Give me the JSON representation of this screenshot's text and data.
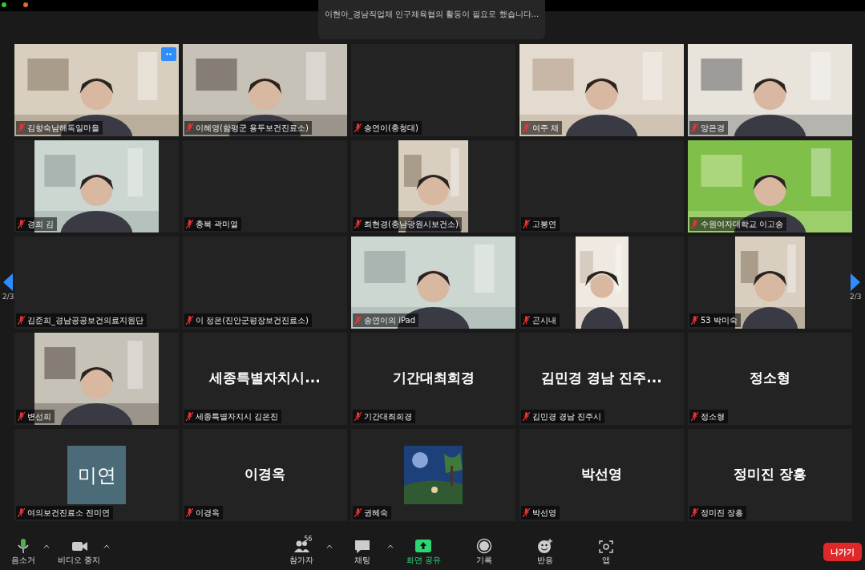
{
  "banner": {
    "text": "이현아_경남직업체 인구체육협의 활동이 필요로 했습니다..."
  },
  "pager": {
    "left": "2/3",
    "right": "2/3"
  },
  "tiles": [
    {
      "kind": "video",
      "label": "김향숙남해독일마을",
      "muted": true,
      "more_button": true
    },
    {
      "kind": "video",
      "label": "이혜영(함평군 용두보건진료소)",
      "muted": true
    },
    {
      "kind": "blank",
      "label": "송연이(충청대)",
      "muted": true
    },
    {
      "kind": "video",
      "label": "여주 채",
      "muted": true
    },
    {
      "kind": "video",
      "label": "양은경",
      "muted": true
    },
    {
      "kind": "portrait_video",
      "label": "경희 김",
      "muted": true
    },
    {
      "kind": "blank",
      "label": "충북 곽미열",
      "muted": true
    },
    {
      "kind": "portrait_video",
      "label": "최현경(충남광원시보건소)",
      "muted": true
    },
    {
      "kind": "blank",
      "label": "고봉연",
      "muted": true
    },
    {
      "kind": "video",
      "label": "수원여자대학교 이고송",
      "muted": true
    },
    {
      "kind": "blank",
      "label": "김준희_경남공공보건의료지원단",
      "muted": true
    },
    {
      "kind": "blank",
      "label": "이 정은(진안군평장보건진료소)",
      "muted": true
    },
    {
      "kind": "video",
      "label": "송연이의 iPad",
      "muted": true
    },
    {
      "kind": "portrait_video",
      "label": "곤시내",
      "muted": true
    },
    {
      "kind": "portrait_video",
      "label": "53 박미숙",
      "muted": true
    },
    {
      "kind": "portrait_video",
      "label": "변선희",
      "muted": true
    },
    {
      "kind": "name",
      "display": "세종특별자치시...",
      "label": "세종특별자치시 김은진",
      "muted": true
    },
    {
      "kind": "name",
      "display": "기간대최희경",
      "label": "기간대최희경",
      "muted": true
    },
    {
      "kind": "name",
      "display": "김민경 경남 진주...",
      "label": "김민경 경남 진주시",
      "muted": true
    },
    {
      "kind": "name",
      "display": "정소형",
      "label": "정소형",
      "muted": true
    },
    {
      "kind": "avatar_text",
      "display": "미연",
      "label": "여의보건진료소 전미연",
      "muted": true
    },
    {
      "kind": "name",
      "display": "이경옥",
      "label": "이경옥",
      "muted": true
    },
    {
      "kind": "avatar_picture",
      "label": "권혜숙",
      "muted": true
    },
    {
      "kind": "name",
      "display": "박선영",
      "label": "박선영",
      "muted": true
    },
    {
      "kind": "name",
      "display": "정미진 장흥",
      "label": "정미진 장흥",
      "muted": true
    }
  ],
  "toolbar": [
    {
      "kind": "mic",
      "label": "음소거",
      "caret": true,
      "highlight": false
    },
    {
      "kind": "camera",
      "label": "비디오 중지",
      "caret": true,
      "highlight": false
    },
    {
      "kind": "participants",
      "label": "참가자",
      "count": "56",
      "caret": true,
      "highlight": false
    },
    {
      "kind": "chat",
      "label": "채팅",
      "caret": true,
      "highlight": false
    },
    {
      "kind": "share",
      "label": "화면 공유",
      "caret": false,
      "highlight": true
    },
    {
      "kind": "record",
      "label": "기록",
      "caret": false,
      "highlight": false
    },
    {
      "kind": "reactions",
      "label": "반응",
      "caret": false,
      "highlight": false
    },
    {
      "kind": "apps",
      "label": "앱",
      "caret": false,
      "highlight": false
    }
  ],
  "leave_button": "나가기"
}
